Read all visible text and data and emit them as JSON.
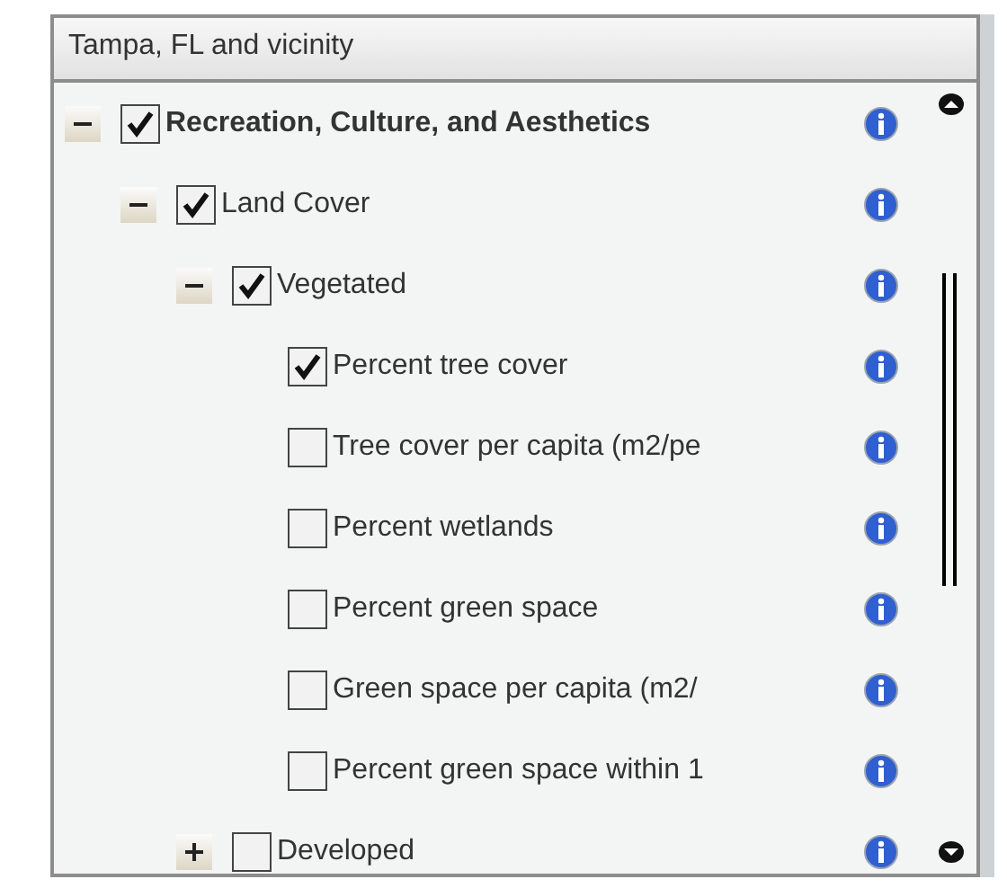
{
  "panel": {
    "title": "Tampa, FL and vicinity"
  },
  "tree": [
    {
      "label": "Recreation, Culture, and Aesthetics",
      "checked": true,
      "expanded": true,
      "children": [
        {
          "label": "Land Cover",
          "checked": true,
          "expanded": true,
          "children": [
            {
              "label": "Vegetated",
              "checked": true,
              "expanded": true,
              "children": [
                {
                  "label": "Percent tree cover",
                  "checked": true
                },
                {
                  "label": "Tree cover per capita (m2/pe",
                  "checked": false
                },
                {
                  "label": "Percent wetlands",
                  "checked": false
                },
                {
                  "label": "Percent green space",
                  "checked": false
                },
                {
                  "label": "Green space per capita (m2/",
                  "checked": false
                },
                {
                  "label": "Percent green space within 1",
                  "checked": false
                }
              ]
            },
            {
              "label": "Developed",
              "checked": false,
              "expanded": false
            }
          ]
        }
      ]
    }
  ]
}
